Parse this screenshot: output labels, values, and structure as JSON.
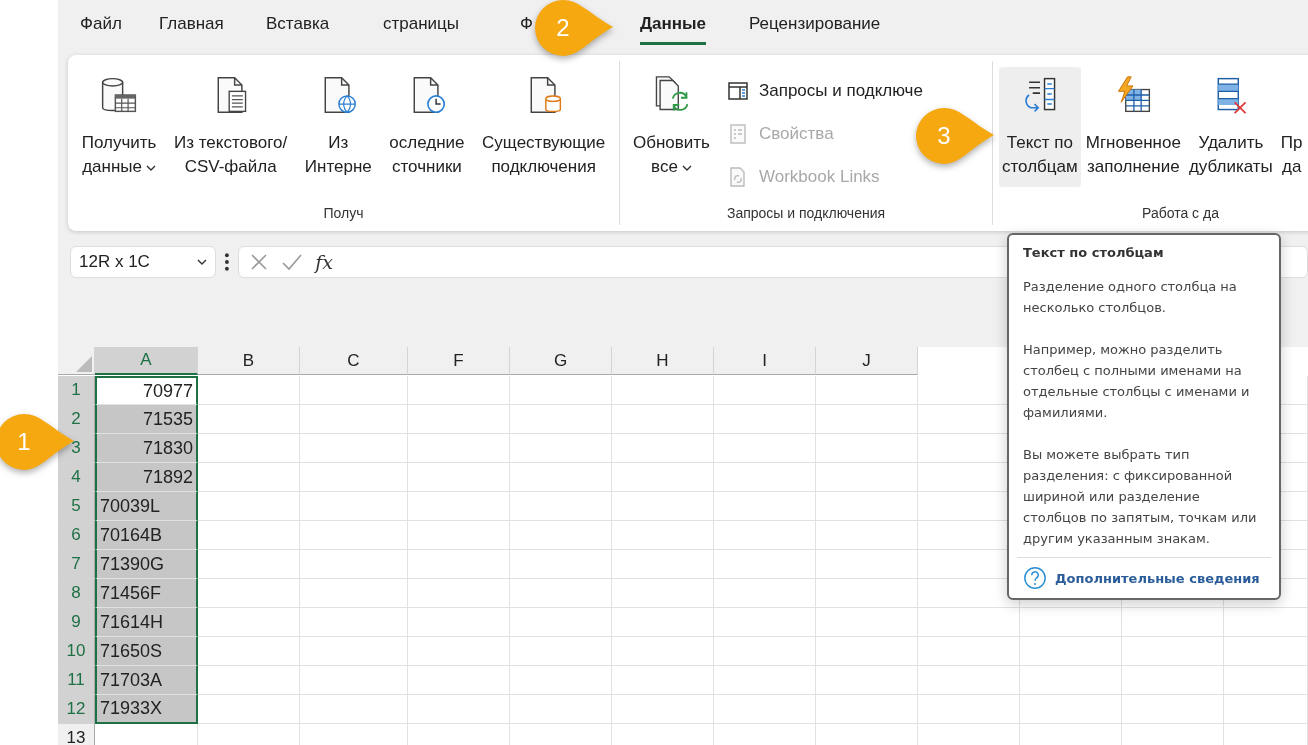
{
  "tabs": [
    {
      "label": "Файл",
      "selected": false
    },
    {
      "label": "Главная",
      "selected": false
    },
    {
      "label": "Вставка",
      "selected": false
    },
    {
      "label": "страницы",
      "selected": false
    },
    {
      "label": "Ф",
      "selected": false
    },
    {
      "label": "Данные",
      "selected": true
    },
    {
      "label": "Рецензирование",
      "selected": false
    }
  ],
  "ribbon": {
    "groups": [
      {
        "label": "Получ",
        "large": [
          {
            "lines": [
              "Получить",
              "данные"
            ],
            "dropdown": true,
            "highlighted": false
          },
          {
            "lines": [
              "Из текстового/",
              "CSV-файла"
            ],
            "dropdown": false,
            "highlighted": false
          },
          {
            "lines": [
              "Из",
              "Интерне"
            ],
            "dropdown": false,
            "highlighted": false
          },
          {
            "lines": [
              "оследние",
              "сточники"
            ],
            "dropdown": false,
            "highlighted": false
          },
          {
            "lines": [
              "Существующие",
              "подключения"
            ],
            "dropdown": false,
            "highlighted": false
          }
        ]
      },
      {
        "label": "Запросы и подключения",
        "large": [
          {
            "lines": [
              "Обновить",
              "все"
            ],
            "dropdown": true,
            "highlighted": false
          }
        ],
        "small": [
          {
            "label": "Запросы и подключе",
            "disabled": false
          },
          {
            "label": "Свойства",
            "disabled": true
          },
          {
            "label": "Workbook Links",
            "disabled": true
          }
        ]
      },
      {
        "label": "Работа с да",
        "large": [
          {
            "lines": [
              "Текст по",
              "столбцам"
            ],
            "dropdown": false,
            "highlighted": true
          },
          {
            "lines": [
              "Мгновенное",
              "заполнение"
            ],
            "dropdown": false,
            "highlighted": false
          },
          {
            "lines": [
              "Удалить",
              "дубликаты"
            ],
            "dropdown": false,
            "highlighted": false
          },
          {
            "lines": [
              "Пр",
              "да"
            ],
            "dropdown": false,
            "highlighted": false
          }
        ]
      }
    ]
  },
  "formula_bar": {
    "name_box": "12R x 1C",
    "fx": "fx"
  },
  "columns": [
    {
      "label": "A",
      "selected": true
    },
    {
      "label": "B",
      "selected": false
    },
    {
      "label": "C",
      "selected": false
    },
    {
      "label": "F",
      "selected": false
    },
    {
      "label": "G",
      "selected": false
    },
    {
      "label": "H",
      "selected": false
    },
    {
      "label": "I",
      "selected": false
    },
    {
      "label": "J",
      "selected": false
    }
  ],
  "rows": [
    {
      "number": "1",
      "selected": true,
      "active": true,
      "value": "70977",
      "kind": "number"
    },
    {
      "number": "2",
      "selected": true,
      "active": false,
      "value": "71535",
      "kind": "number"
    },
    {
      "number": "3",
      "selected": true,
      "active": false,
      "value": "71830",
      "kind": "number"
    },
    {
      "number": "4",
      "selected": true,
      "active": false,
      "value": "71892",
      "kind": "number"
    },
    {
      "number": "5",
      "selected": true,
      "active": false,
      "value": "70039L",
      "kind": "text"
    },
    {
      "number": "6",
      "selected": true,
      "active": false,
      "value": "70164B",
      "kind": "text"
    },
    {
      "number": "7",
      "selected": true,
      "active": false,
      "value": "71390G",
      "kind": "text"
    },
    {
      "number": "8",
      "selected": true,
      "active": false,
      "value": "71456F",
      "kind": "text"
    },
    {
      "number": "9",
      "selected": true,
      "active": false,
      "value": "71614H",
      "kind": "text"
    },
    {
      "number": "10",
      "selected": true,
      "active": false,
      "value": "71650S",
      "kind": "text"
    },
    {
      "number": "11",
      "selected": true,
      "active": false,
      "value": "71703A",
      "kind": "text"
    },
    {
      "number": "12",
      "selected": true,
      "active": false,
      "value": "71933X",
      "kind": "text"
    },
    {
      "number": "13",
      "selected": false,
      "active": false
    }
  ],
  "tooltip": {
    "title": "Текст по столбцам",
    "paragraphs": [
      "Разделение одного столбца на несколько столбцов.",
      "Например, можно разделить столбец с полными именами на отдельные столбцы с именами и фамилиями.",
      "Вы можете выбрать тип разделения: с фиксированной шириной или разделение столбцов по запятым, точкам или другим указанным знакам."
    ],
    "link": "Дополнительные сведения"
  },
  "callouts": [
    {
      "label": "1"
    },
    {
      "label": "2"
    },
    {
      "label": "3"
    }
  ]
}
